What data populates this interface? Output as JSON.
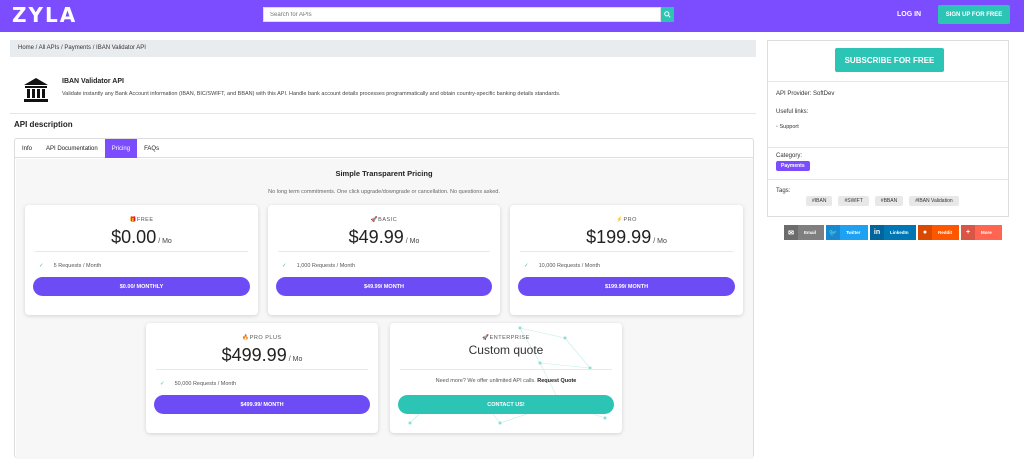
{
  "header": {
    "logo": "ZYLA",
    "search_placeholder": "Search for APIs",
    "login": "LOG IN",
    "signup": "SIGN UP FOR FREE"
  },
  "breadcrumb": "Home / All APIs / Payments / IBAN Validator API",
  "api": {
    "title": "IBAN Validator API",
    "description": "Validate instantly any Bank Account information (IBAN, BIC/SWIFT, and BBAN) with this API. Handle bank account details processes programmatically and obtain country-specific banking details standards."
  },
  "section_title": "API description",
  "tabs": [
    {
      "label": "Info"
    },
    {
      "label": "API Documentation"
    },
    {
      "label": "Pricing"
    },
    {
      "label": "FAQs"
    }
  ],
  "pricing": {
    "title": "Simple Transparent Pricing",
    "subtitle": "No long term commitments. One click upgrade/downgrade or cancellation. No questions asked.",
    "per": "/ Mo",
    "plans": [
      {
        "name": "FREE",
        "price": "$0.00",
        "requests": "5 Requests / Month",
        "button": "$0.00/ MONTHLY"
      },
      {
        "name": "BASIC",
        "price": "$49.99",
        "requests": "1,000 Requests / Month",
        "button": "$49.99/ MONTH"
      },
      {
        "name": "PRO",
        "price": "$199.99",
        "requests": "10,000 Requests / Month",
        "button": "$199.99/ MONTH"
      },
      {
        "name": "PRO PLUS",
        "price": "$499.99",
        "requests": "50,000 Requests / Month",
        "button": "$499.99/ MONTH"
      }
    ],
    "enterprise": {
      "name": "ENTERPRISE",
      "price": "Custom quote",
      "text": "Need more? We offer unlimited API calls.",
      "link": "Request Quote",
      "button": "CONTACT US!"
    }
  },
  "sidebar": {
    "subscribe": "SUBSCRIBE FOR FREE",
    "provider": "API Provider: SoftDev",
    "useful_links": "Useful links:",
    "support": "Support",
    "category_label": "Category:",
    "category": "Payments",
    "tags_label": "Tags:",
    "tags": [
      "#IBAN",
      "#SWIFT",
      "#BBAN",
      "#IBAN Validation"
    ]
  },
  "share": [
    {
      "label": "Email",
      "color": "#7f7f7f"
    },
    {
      "label": "Twitter",
      "color": "#1da1f2"
    },
    {
      "label": "LinkedIn",
      "color": "#0077b5"
    },
    {
      "label": "Reddit",
      "color": "#ff5700"
    },
    {
      "label": "More",
      "color": "#ff6550"
    }
  ],
  "colors": {
    "brand": "#7c4dff",
    "accent": "#2bc4b5",
    "button": "#6d4cf6"
  }
}
